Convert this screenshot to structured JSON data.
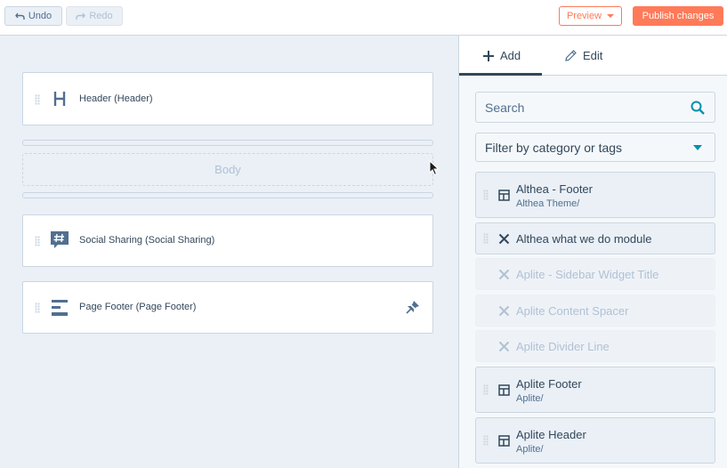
{
  "toolbar": {
    "undo_label": "Undo",
    "redo_label": "Redo",
    "preview_label": "Preview",
    "publish_label": "Publish changes"
  },
  "canvas": {
    "modules": [
      {
        "label": "Header (Header)",
        "icon": "header-icon"
      },
      {
        "label": "Social Sharing (Social Sharing)",
        "icon": "hashtag-chat-icon"
      },
      {
        "label": "Page Footer (Page Footer)",
        "icon": "footer-layout-icon"
      }
    ],
    "body_label": "Body"
  },
  "panel": {
    "tabs": [
      {
        "label": "Add",
        "icon": "plus-icon",
        "active": true
      },
      {
        "label": "Edit",
        "icon": "pencil-icon",
        "active": false
      }
    ],
    "search_placeholder": "Search",
    "filter_label": "Filter by category or tags",
    "modules": [
      {
        "title": "Althea - Footer",
        "subtitle": "Althea Theme/",
        "icon": "layout-icon",
        "disabled": false
      },
      {
        "title": "Althea what we do module",
        "subtitle": "",
        "icon": "x-tool-icon",
        "disabled": false
      },
      {
        "title": "Aplite - Sidebar Widget Title",
        "subtitle": "",
        "icon": "x-tool-icon",
        "disabled": true
      },
      {
        "title": "Aplite Content Spacer",
        "subtitle": "",
        "icon": "x-tool-icon",
        "disabled": true
      },
      {
        "title": "Aplite Divider Line",
        "subtitle": "",
        "icon": "x-tool-icon",
        "disabled": true
      },
      {
        "title": "Aplite Footer",
        "subtitle": "Aplite/",
        "icon": "layout-icon",
        "disabled": false
      },
      {
        "title": "Aplite Header",
        "subtitle": "Aplite/",
        "icon": "layout-icon",
        "disabled": false
      }
    ]
  },
  "colors": {
    "accent": "#ff7a59",
    "text": "#33475b",
    "border": "#cbd6e2",
    "canvas_bg": "#eaf0f6",
    "link": "#0091ae"
  }
}
